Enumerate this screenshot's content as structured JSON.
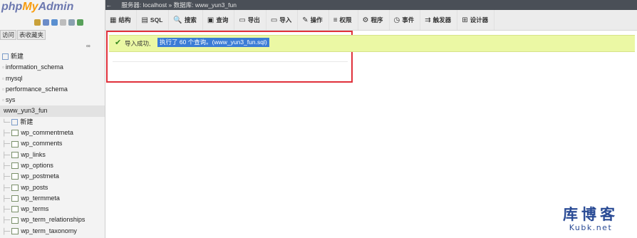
{
  "app": {
    "logo_php": "php",
    "logo_my": "My",
    "logo_admin": "Admin"
  },
  "sidebar": {
    "tabs": [
      "访问",
      "表收藏夹"
    ],
    "quick_icons": [
      {
        "name": "home-icon",
        "color": "#c9a13a"
      },
      {
        "name": "exit-icon",
        "color": "#6c8cc8"
      },
      {
        "name": "help-icon",
        "color": "#5a8fd0"
      },
      {
        "name": "docs-icon",
        "color": "#bdbdbd"
      },
      {
        "name": "settings-icon",
        "color": "#8aa0b0"
      },
      {
        "name": "reload-icon",
        "color": "#58a05a"
      }
    ],
    "link_icon": "∞",
    "tree": [
      {
        "kind": "new",
        "label": "新建"
      },
      {
        "kind": "db",
        "label": "information_schema"
      },
      {
        "kind": "db",
        "label": "mysql"
      },
      {
        "kind": "db",
        "label": "performance_schema"
      },
      {
        "kind": "db",
        "label": "sys"
      },
      {
        "kind": "db_selected",
        "label": "www_yun3_fun"
      },
      {
        "kind": "subnew",
        "label": "新建"
      },
      {
        "kind": "table",
        "label": "wp_commentmeta"
      },
      {
        "kind": "table",
        "label": "wp_comments"
      },
      {
        "kind": "table",
        "label": "wp_links"
      },
      {
        "kind": "table",
        "label": "wp_options"
      },
      {
        "kind": "table",
        "label": "wp_postmeta"
      },
      {
        "kind": "table",
        "label": "wp_posts"
      },
      {
        "kind": "table",
        "label": "wp_termmeta"
      },
      {
        "kind": "table",
        "label": "wp_terms"
      },
      {
        "kind": "table",
        "label": "wp_term_relationships"
      },
      {
        "kind": "table",
        "label": "wp_term_taxonomy"
      }
    ]
  },
  "breadcrumb": {
    "server": "服务器: localhost",
    "separator": "»",
    "database": "数据库: www_yun3_fun"
  },
  "tabs": [
    {
      "label": "结构",
      "icon": "structure-icon",
      "glyph": "▦"
    },
    {
      "label": "SQL",
      "icon": "sql-icon",
      "glyph": "▤"
    },
    {
      "label": "搜索",
      "icon": "search-icon",
      "glyph": "🔍"
    },
    {
      "label": "查询",
      "icon": "query-icon",
      "glyph": "▣"
    },
    {
      "label": "导出",
      "icon": "export-icon",
      "glyph": "▭"
    },
    {
      "label": "导入",
      "icon": "import-icon",
      "glyph": "▭"
    },
    {
      "label": "操作",
      "icon": "operations-icon",
      "glyph": "✎"
    },
    {
      "label": "权限",
      "icon": "privileges-icon",
      "glyph": "≡"
    },
    {
      "label": "程序",
      "icon": "routines-icon",
      "glyph": "⚙"
    },
    {
      "label": "事件",
      "icon": "events-icon",
      "glyph": "◷"
    },
    {
      "label": "触发器",
      "icon": "triggers-icon",
      "glyph": "⇉"
    },
    {
      "label": "设计器",
      "icon": "designer-icon",
      "glyph": "⊞"
    }
  ],
  "notice": {
    "label": "导入成功,",
    "selected_text": "执行了 60 个查询。(www_yun3_fun.sql)",
    "icon": "check-icon"
  },
  "watermark": {
    "cn": "库博客",
    "en": "Kubk.net"
  },
  "colors": {
    "accent_red": "#e0313b",
    "notice_bg": "#ebf8a4",
    "selection": "#3b7cd6"
  }
}
